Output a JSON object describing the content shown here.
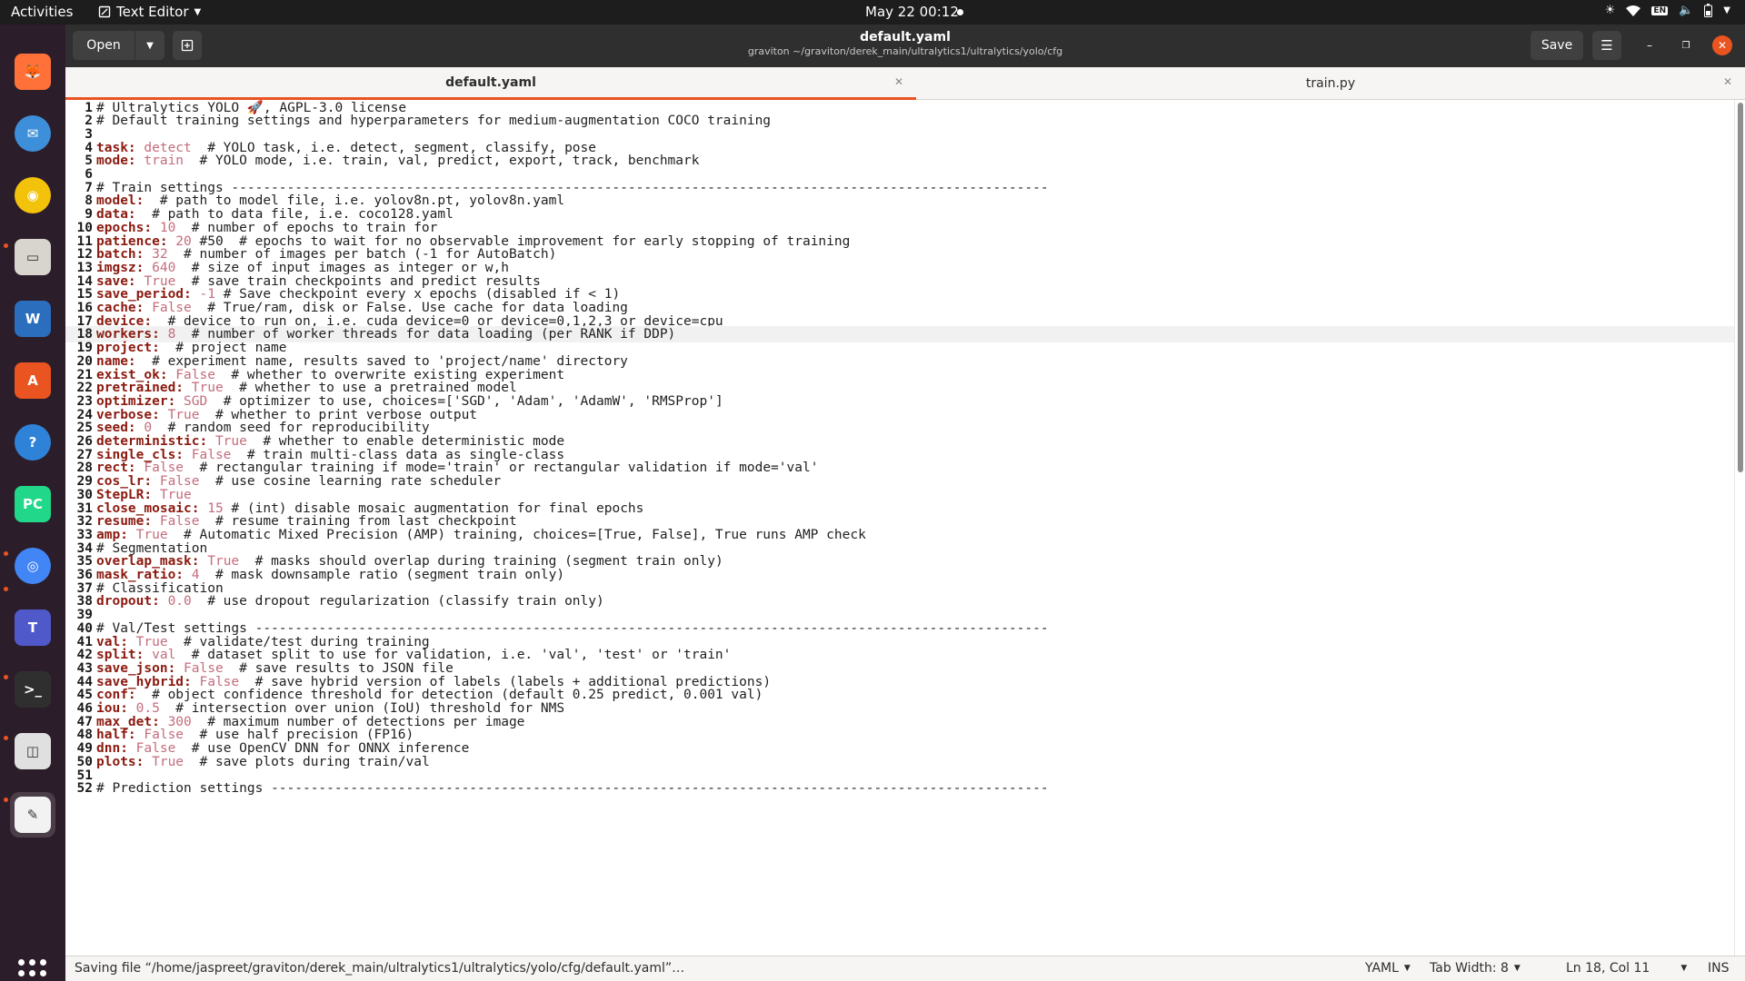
{
  "topbar": {
    "activities": "Activities",
    "app_name": "Text Editor",
    "clock": "May 22  00:12",
    "tray_en": "EN"
  },
  "header": {
    "open_label": "Open",
    "save_label": "Save",
    "title": "default.yaml",
    "subtitle": "graviton ~/graviton/derek_main/ultralytics1/ultralytics/yolo/cfg"
  },
  "tabs": [
    {
      "label": "default.yaml",
      "active": true
    },
    {
      "label": "train.py",
      "active": false
    }
  ],
  "dock": [
    {
      "name": "firefox-icon",
      "color": "#ff7139"
    },
    {
      "name": "thunderbird-icon",
      "color": "#3d8fd9"
    },
    {
      "name": "rhythmbox-icon",
      "color": "#f3c20b"
    },
    {
      "name": "files-icon",
      "color": "#d8d4ce"
    },
    {
      "name": "libreoffice-writer-icon",
      "color": "#2a6ebd"
    },
    {
      "name": "app-center-icon",
      "color": "#e95420"
    },
    {
      "name": "help-icon",
      "color": "#2e83d8"
    },
    {
      "name": "pycharm-icon",
      "color": "#21d789"
    },
    {
      "name": "chrome-icon",
      "color": "#4285f4"
    },
    {
      "name": "teams-icon",
      "color": "#5059c9"
    },
    {
      "name": "terminal-icon",
      "color": "#2f2f2f"
    },
    {
      "name": "document-viewer-icon",
      "color": "#e0e0e0"
    },
    {
      "name": "text-editor-icon",
      "color": "#f2f2f2"
    }
  ],
  "editor": {
    "current_line": 18,
    "lines": [
      {
        "n": "1",
        "key": "",
        "val": "",
        "comment": "# Ultralytics YOLO 🚀, AGPL-3.0 license"
      },
      {
        "n": "2",
        "key": "",
        "val": "",
        "comment": "# Default training settings and hyperparameters for medium-augmentation COCO training"
      },
      {
        "n": "3",
        "key": "",
        "val": "",
        "comment": ""
      },
      {
        "n": "4",
        "key": "task:",
        "val": " detect",
        "comment": "  # YOLO task, i.e. detect, segment, classify, pose"
      },
      {
        "n": "5",
        "key": "mode:",
        "val": " train",
        "comment": "  # YOLO mode, i.e. train, val, predict, export, track, benchmark"
      },
      {
        "n": "6",
        "key": "",
        "val": "",
        "comment": ""
      },
      {
        "n": "7",
        "key": "",
        "val": "",
        "comment": "# Train settings -------------------------------------------------------------------------------------------------------"
      },
      {
        "n": "8",
        "key": "model:",
        "val": "",
        "comment": "  # path to model file, i.e. yolov8n.pt, yolov8n.yaml"
      },
      {
        "n": "9",
        "key": "data:",
        "val": "",
        "comment": "  # path to data file, i.e. coco128.yaml"
      },
      {
        "n": "10",
        "key": "epochs:",
        "val": " 10",
        "comment": "  # number of epochs to train for"
      },
      {
        "n": "11",
        "key": "patience:",
        "val": " 20",
        "comment": " #50  # epochs to wait for no observable improvement for early stopping of training"
      },
      {
        "n": "12",
        "key": "batch:",
        "val": " 32",
        "comment": "  # number of images per batch (-1 for AutoBatch)"
      },
      {
        "n": "13",
        "key": "imgsz:",
        "val": " 640",
        "comment": "  # size of input images as integer or w,h"
      },
      {
        "n": "14",
        "key": "save:",
        "val": " True",
        "comment": "  # save train checkpoints and predict results"
      },
      {
        "n": "15",
        "key": "save_period:",
        "val": " -1",
        "comment": " # Save checkpoint every x epochs (disabled if < 1)"
      },
      {
        "n": "16",
        "key": "cache:",
        "val": " False",
        "comment": "  # True/ram, disk or False. Use cache for data loading"
      },
      {
        "n": "17",
        "key": "device:",
        "val": "",
        "comment": "  # device to run on, i.e. cuda device=0 or device=0,1,2,3 or device=cpu"
      },
      {
        "n": "18",
        "key": "workers:",
        "val": " 8",
        "comment": "  # number of worker threads for data loading (per RANK if DDP)"
      },
      {
        "n": "19",
        "key": "project:",
        "val": "",
        "comment": "  # project name"
      },
      {
        "n": "20",
        "key": "name:",
        "val": "",
        "comment": "  # experiment name, results saved to 'project/name' directory"
      },
      {
        "n": "21",
        "key": "exist_ok:",
        "val": " False",
        "comment": "  # whether to overwrite existing experiment"
      },
      {
        "n": "22",
        "key": "pretrained:",
        "val": " True",
        "comment": "  # whether to use a pretrained model"
      },
      {
        "n": "23",
        "key": "optimizer:",
        "val": " SGD",
        "comment": "  # optimizer to use, choices=['SGD', 'Adam', 'AdamW', 'RMSProp']"
      },
      {
        "n": "24",
        "key": "verbose:",
        "val": " True",
        "comment": "  # whether to print verbose output"
      },
      {
        "n": "25",
        "key": "seed:",
        "val": " 0",
        "comment": "  # random seed for reproducibility"
      },
      {
        "n": "26",
        "key": "deterministic:",
        "val": " True",
        "comment": "  # whether to enable deterministic mode"
      },
      {
        "n": "27",
        "key": "single_cls:",
        "val": " False",
        "comment": "  # train multi-class data as single-class"
      },
      {
        "n": "28",
        "key": "rect:",
        "val": " False",
        "comment": "  # rectangular training if mode='train' or rectangular validation if mode='val'"
      },
      {
        "n": "29",
        "key": "cos_lr:",
        "val": " False",
        "comment": "  # use cosine learning rate scheduler"
      },
      {
        "n": "30",
        "key": "StepLR:",
        "val": " True",
        "comment": ""
      },
      {
        "n": "31",
        "key": "close_mosaic:",
        "val": " 15",
        "comment": " # (int) disable mosaic augmentation for final epochs"
      },
      {
        "n": "32",
        "key": "resume:",
        "val": " False",
        "comment": "  # resume training from last checkpoint"
      },
      {
        "n": "33",
        "key": "amp:",
        "val": " True",
        "comment": "  # Automatic Mixed Precision (AMP) training, choices=[True, False], True runs AMP check"
      },
      {
        "n": "34",
        "key": "",
        "val": "",
        "comment": "# Segmentation"
      },
      {
        "n": "35",
        "key": "overlap_mask:",
        "val": " True",
        "comment": "  # masks should overlap during training (segment train only)"
      },
      {
        "n": "36",
        "key": "mask_ratio:",
        "val": " 4",
        "comment": "  # mask downsample ratio (segment train only)"
      },
      {
        "n": "37",
        "key": "",
        "val": "",
        "comment": "# Classification"
      },
      {
        "n": "38",
        "key": "dropout:",
        "val": " 0.0",
        "comment": "  # use dropout regularization (classify train only)"
      },
      {
        "n": "39",
        "key": "",
        "val": "",
        "comment": ""
      },
      {
        "n": "40",
        "key": "",
        "val": "",
        "comment": "# Val/Test settings ----------------------------------------------------------------------------------------------------"
      },
      {
        "n": "41",
        "key": "val:",
        "val": " True",
        "comment": "  # validate/test during training"
      },
      {
        "n": "42",
        "key": "split:",
        "val": " val",
        "comment": "  # dataset split to use for validation, i.e. 'val', 'test' or 'train'"
      },
      {
        "n": "43",
        "key": "save_json:",
        "val": " False",
        "comment": "  # save results to JSON file"
      },
      {
        "n": "44",
        "key": "save_hybrid:",
        "val": " False",
        "comment": "  # save hybrid version of labels (labels + additional predictions)"
      },
      {
        "n": "45",
        "key": "conf:",
        "val": "",
        "comment": "  # object confidence threshold for detection (default 0.25 predict, 0.001 val)"
      },
      {
        "n": "46",
        "key": "iou:",
        "val": " 0.5",
        "comment": "  # intersection over union (IoU) threshold for NMS"
      },
      {
        "n": "47",
        "key": "max_det:",
        "val": " 300",
        "comment": "  # maximum number of detections per image"
      },
      {
        "n": "48",
        "key": "half:",
        "val": " False",
        "comment": "  # use half precision (FP16)"
      },
      {
        "n": "49",
        "key": "dnn:",
        "val": " False",
        "comment": "  # use OpenCV DNN for ONNX inference"
      },
      {
        "n": "50",
        "key": "plots:",
        "val": " True",
        "comment": "  # save plots during train/val"
      },
      {
        "n": "51",
        "key": "",
        "val": "",
        "comment": ""
      },
      {
        "n": "52",
        "key": "",
        "val": "",
        "comment": "# Prediction settings --------------------------------------------------------------------------------------------------"
      }
    ]
  },
  "status": {
    "message": "Saving file “/home/jaspreet/graviton/derek_main/ultralytics1/ultralytics/yolo/cfg/default.yaml”…",
    "language": "YAML",
    "tab_width": "Tab Width: 8",
    "position": "Ln 18, Col 11",
    "mode": "INS"
  },
  "colors": {
    "accent": "#e95420",
    "key": "#8b1a10",
    "value": "#c46c7d"
  }
}
